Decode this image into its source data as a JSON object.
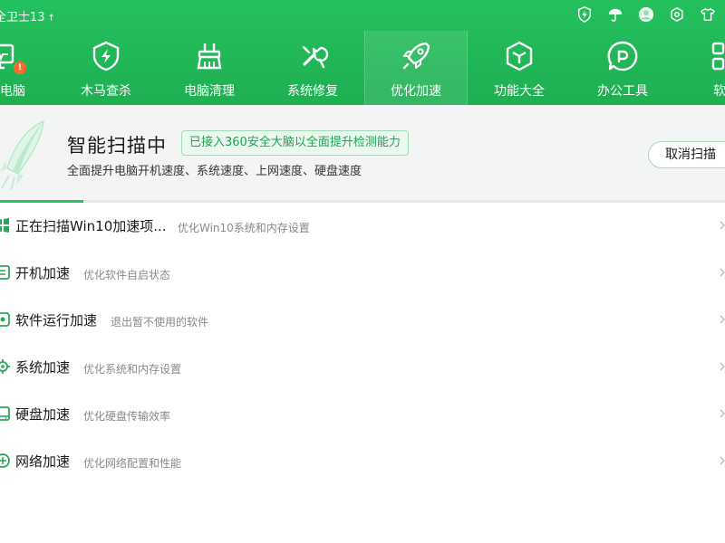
{
  "app": {
    "title": "全卫士13",
    "title_arrow": "↑"
  },
  "window_icons": [
    "shield-bolt-icon",
    "umbrella-icon",
    "avatar",
    "settings-icon",
    "skin-shirt-icon"
  ],
  "nav": {
    "items": [
      {
        "label": "电脑",
        "icon": "computer-icon",
        "badge": "!"
      },
      {
        "label": "木马查杀",
        "icon": "trojan-shield-icon"
      },
      {
        "label": "电脑清理",
        "icon": "broom-icon"
      },
      {
        "label": "系统修复",
        "icon": "wrench-icon"
      },
      {
        "label": "优化加速",
        "icon": "rocket-icon",
        "active": true
      },
      {
        "label": "功能大全",
        "icon": "cube-icon"
      },
      {
        "label": "办公工具",
        "icon": "chat-bubble-icon"
      },
      {
        "label": "软件",
        "icon": "app-grid-icon"
      }
    ]
  },
  "scan": {
    "title": "智能扫描中",
    "tag": "已接入360安全大脑以全面提升检测能力",
    "subtitle": "全面提升电脑开机速度、系统速度、上网速度、硬盘速度",
    "cancel_label": "取消扫描",
    "progress": 0.115
  },
  "tasks": [
    {
      "title": "正在扫描Win10加速项...",
      "desc": "优化Win10系统和内存设置",
      "icon": "windows-icon"
    },
    {
      "title": "开机加速",
      "desc": "优化软件自启状态",
      "icon": "power-icon"
    },
    {
      "title": "软件运行加速",
      "desc": "退出暂不使用的软件",
      "icon": "app-icon"
    },
    {
      "title": "系统加速",
      "desc": "优化系统和内存设置",
      "icon": "gear-icon"
    },
    {
      "title": "硬盘加速",
      "desc": "优化硬盘传输效率",
      "icon": "disk-icon"
    },
    {
      "title": "网络加速",
      "desc": "优化网络配置和性能",
      "icon": "network-icon"
    }
  ],
  "colors": {
    "brand_green": "#21b757",
    "accent_green": "#27c063",
    "tag_text": "#1ea350",
    "badge_orange": "#ff6b2c"
  }
}
